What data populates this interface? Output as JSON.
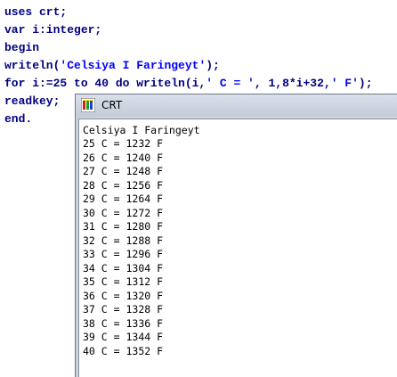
{
  "editor": {
    "lines": [
      {
        "parts": [
          {
            "cls": "plain",
            "text": "uses crt;"
          }
        ]
      },
      {
        "parts": [
          {
            "cls": "plain",
            "text": "var i:integer;"
          }
        ]
      },
      {
        "parts": [
          {
            "cls": "plain",
            "text": "begin"
          }
        ]
      },
      {
        "parts": [
          {
            "cls": "plain",
            "text": "writeln("
          },
          {
            "cls": "str",
            "text": "'Celsiya I Faringeyt'"
          },
          {
            "cls": "plain",
            "text": ");"
          }
        ]
      },
      {
        "parts": [
          {
            "cls": "plain",
            "text": "for i:=25 to 40 do writeln(i,"
          },
          {
            "cls": "str",
            "text": "' C = '"
          },
          {
            "cls": "plain",
            "text": ", 1,8*i+32,"
          },
          {
            "cls": "str",
            "text": "' F'"
          },
          {
            "cls": "plain",
            "text": ");"
          }
        ]
      },
      {
        "parts": [
          {
            "cls": "plain",
            "text": "readkey;"
          }
        ]
      },
      {
        "parts": [
          {
            "cls": "plain",
            "text": "end."
          }
        ]
      }
    ]
  },
  "crt": {
    "title": "CRT",
    "header": "Celsiya I Faringeyt",
    "rows": [
      {
        "i": "25",
        "sep": " C = ",
        "value": "1232",
        "unit": " F"
      },
      {
        "i": "26",
        "sep": " C = ",
        "value": "1240",
        "unit": " F"
      },
      {
        "i": "27",
        "sep": " C = ",
        "value": "1248",
        "unit": " F"
      },
      {
        "i": "28",
        "sep": " C = ",
        "value": "1256",
        "unit": " F"
      },
      {
        "i": "29",
        "sep": " C = ",
        "value": "1264",
        "unit": " F"
      },
      {
        "i": "30",
        "sep": " C = ",
        "value": "1272",
        "unit": " F"
      },
      {
        "i": "31",
        "sep": " C = ",
        "value": "1280",
        "unit": " F"
      },
      {
        "i": "32",
        "sep": " C = ",
        "value": "1288",
        "unit": " F"
      },
      {
        "i": "33",
        "sep": " C = ",
        "value": "1296",
        "unit": " F"
      },
      {
        "i": "34",
        "sep": " C = ",
        "value": "1304",
        "unit": " F"
      },
      {
        "i": "35",
        "sep": " C = ",
        "value": "1312",
        "unit": " F"
      },
      {
        "i": "36",
        "sep": " C = ",
        "value": "1320",
        "unit": " F"
      },
      {
        "i": "37",
        "sep": " C = ",
        "value": "1328",
        "unit": " F"
      },
      {
        "i": "38",
        "sep": " C = ",
        "value": "1336",
        "unit": " F"
      },
      {
        "i": "39",
        "sep": " C = ",
        "value": "1344",
        "unit": " F"
      },
      {
        "i": "40",
        "sep": " C = ",
        "value": "1352",
        "unit": " F"
      }
    ]
  },
  "icons": {
    "crt_app": "crt-app-icon"
  }
}
